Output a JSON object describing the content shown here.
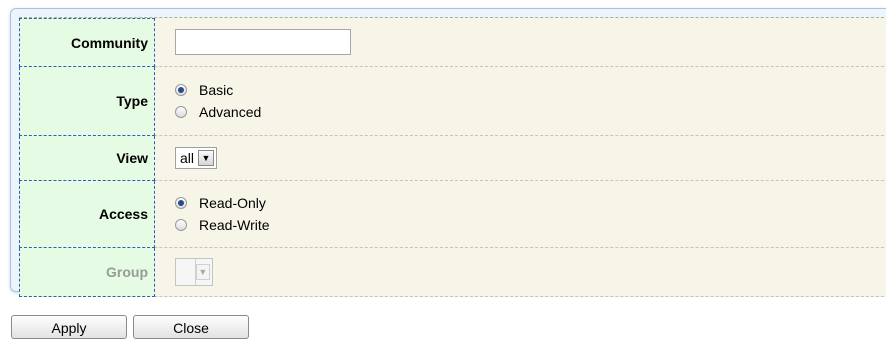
{
  "form": {
    "community": {
      "label": "Community",
      "value": ""
    },
    "type": {
      "label": "Type",
      "options": [
        {
          "label": "Basic",
          "checked": true
        },
        {
          "label": "Advanced",
          "checked": false
        }
      ]
    },
    "view": {
      "label": "View",
      "selected": "all"
    },
    "access": {
      "label": "Access",
      "options": [
        {
          "label": "Read-Only",
          "checked": true
        },
        {
          "label": "Read-Write",
          "checked": false
        }
      ]
    },
    "group": {
      "label": "Group",
      "selected": "",
      "disabled": true
    }
  },
  "buttons": {
    "apply": "Apply",
    "close": "Close"
  },
  "icons": {
    "dropdown": "chevron-down-icon"
  }
}
